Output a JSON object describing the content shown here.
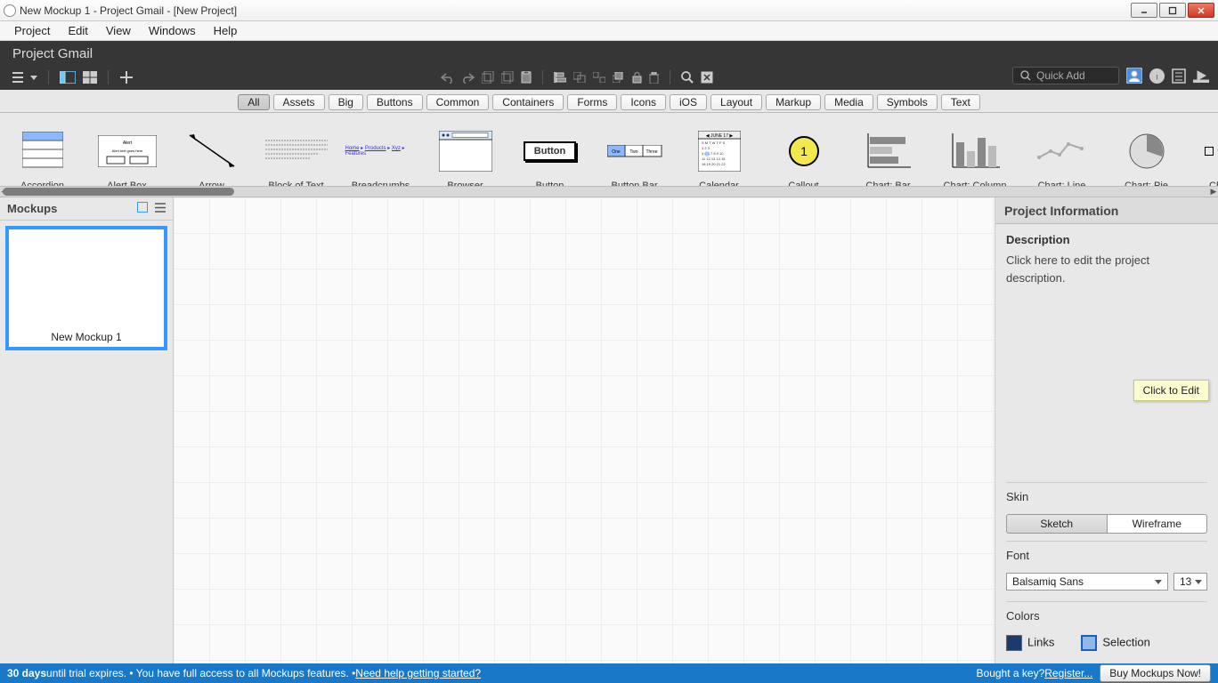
{
  "window": {
    "title": "New Mockup 1 - Project Gmail - [New Project]"
  },
  "menubar": [
    "Project",
    "Edit",
    "View",
    "Windows",
    "Help"
  ],
  "projectName": "Project Gmail",
  "quickAdd": {
    "placeholder": "Quick Add"
  },
  "categories": [
    "All",
    "Assets",
    "Big",
    "Buttons",
    "Common",
    "Containers",
    "Forms",
    "Icons",
    "iOS",
    "Layout",
    "Markup",
    "Media",
    "Symbols",
    "Text"
  ],
  "activeCategory": "All",
  "library": [
    "Accordion",
    "Alert Box",
    "Arrow",
    "Block of Text",
    "Breadcrumbs",
    "Browser",
    "Button",
    "Button Bar",
    "Calendar",
    "Callout",
    "Chart: Bar",
    "Chart: Column",
    "Chart: Line",
    "Chart: Pie",
    "Checkbox"
  ],
  "mockupsPanel": {
    "title": "Mockups",
    "items": [
      "New Mockup 1"
    ]
  },
  "rightPanel": {
    "title": "Project Information",
    "descLabel": "Description",
    "descText": "Click here to edit the project description.",
    "tooltip": "Click to Edit",
    "skinLabel": "Skin",
    "skinOptions": [
      "Sketch",
      "Wireframe"
    ],
    "skinActive": "Sketch",
    "fontLabel": "Font",
    "fontName": "Balsamiq Sans",
    "fontSize": "13",
    "colorsLabel": "Colors",
    "linksLabel": "Links",
    "linksColor": "#1b3b6f",
    "selectionLabel": "Selection",
    "selectionColor": "#8fb8e8"
  },
  "status": {
    "daysBold": "30 days",
    "trial": " until trial expires.  •  You have full access to all Mockups features.  •  ",
    "helpLink": "Need help getting started?",
    "boughtKey": "Bought a key? ",
    "register": "Register...",
    "buy": "Buy Mockups Now!"
  }
}
